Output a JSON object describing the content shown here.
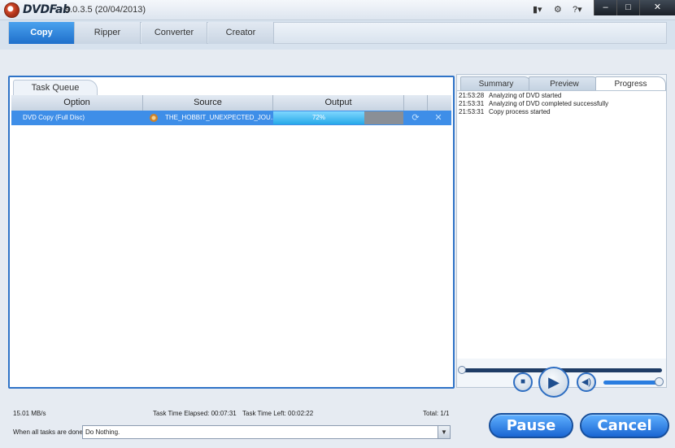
{
  "app": {
    "brand": "DVDFab",
    "version": "9.0.3.5 (20/04/2013)"
  },
  "titlebar": {
    "layout_icon": "▮▾",
    "settings_icon": "⚙",
    "help_icon": "?▾",
    "minimize": "–",
    "maximize": "□",
    "close": "✕"
  },
  "main_tabs": [
    "Copy",
    "Ripper",
    "Converter",
    "Creator"
  ],
  "task_queue": {
    "tab_label": "Task Queue",
    "columns": [
      "Option",
      "Source",
      "Output"
    ],
    "rows": [
      {
        "option": "DVD Copy (Full Disc)",
        "source": "THE_HOBBIT_UNEXPECTED_JOU...",
        "progress_label": "72%",
        "progress_value": 0.72
      }
    ]
  },
  "right_tabs": [
    "Summary",
    "Preview",
    "Progress"
  ],
  "log": [
    {
      "time": "21:53:28",
      "message": "Analyzing of DVD started"
    },
    {
      "time": "21:53:31",
      "message": "Analyzing of DVD completed successfully"
    },
    {
      "time": "21:53:31",
      "message": "Copy process started"
    }
  ],
  "status": {
    "speed": "15.01 MB/s",
    "elapsed": "Task Time Elapsed: 00:07:31",
    "left": "Task Time Left: 00:02:22",
    "total": "Total: 1/1"
  },
  "completion": {
    "label": "When all tasks are done:",
    "selected": "Do Nothing."
  },
  "buttons": {
    "pause": "Pause",
    "cancel": "Cancel"
  },
  "colors": {
    "accent": "#1f6fcb",
    "selection": "#3e8ee8",
    "progress_fill": "#26a9e8"
  }
}
